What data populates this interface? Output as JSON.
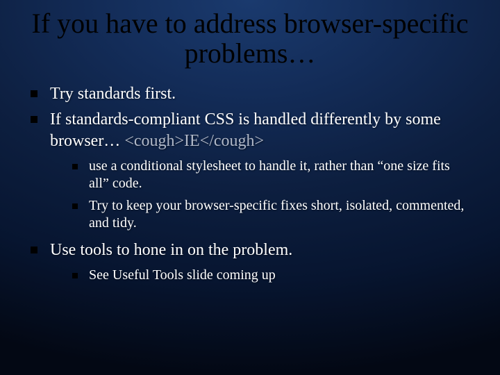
{
  "title": "If you have to address browser-specific problems…",
  "b1": "Try standards first.",
  "b2a": "If standards-compliant CSS is handled differently by some browser… ",
  "b2b": "<cough>IE</cough>",
  "b2s1": " use a conditional stylesheet to handle it, rather than “one size fits all” code.",
  "b2s2": "Try to keep your browser-specific fixes short, isolated, commented, and tidy.",
  "b3": "Use tools to hone in on the problem.",
  "b3s1": "See Useful Tools slide coming up"
}
